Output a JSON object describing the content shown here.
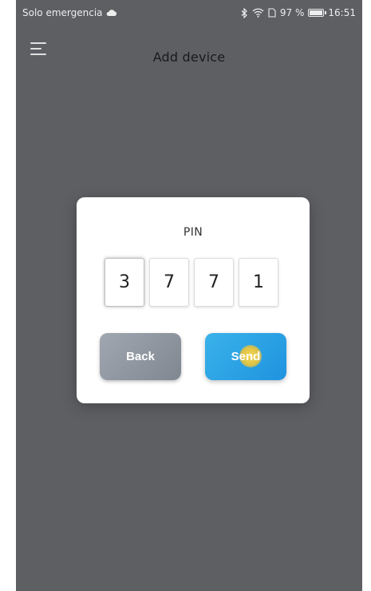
{
  "status_bar": {
    "carrier": "Solo emergencia",
    "battery_percent": "97 %",
    "battery_level": 0.97,
    "time": "16:51"
  },
  "header": {
    "title": "Add device"
  },
  "dialog": {
    "title": "PIN",
    "pin_digits": [
      "3",
      "7",
      "7",
      "1"
    ],
    "back_label": "Back",
    "send_label": "Send"
  },
  "colors": {
    "background_dim": "#5f6165",
    "back_button": "#8c939c",
    "send_button": "#2ba1e4"
  },
  "icons": {
    "menu": "hamburger-menu-icon",
    "cloud": "cloud-icon",
    "bluetooth": "bluetooth-icon",
    "wifi": "wifi-icon",
    "sim": "sim-icon",
    "battery": "battery-icon"
  }
}
